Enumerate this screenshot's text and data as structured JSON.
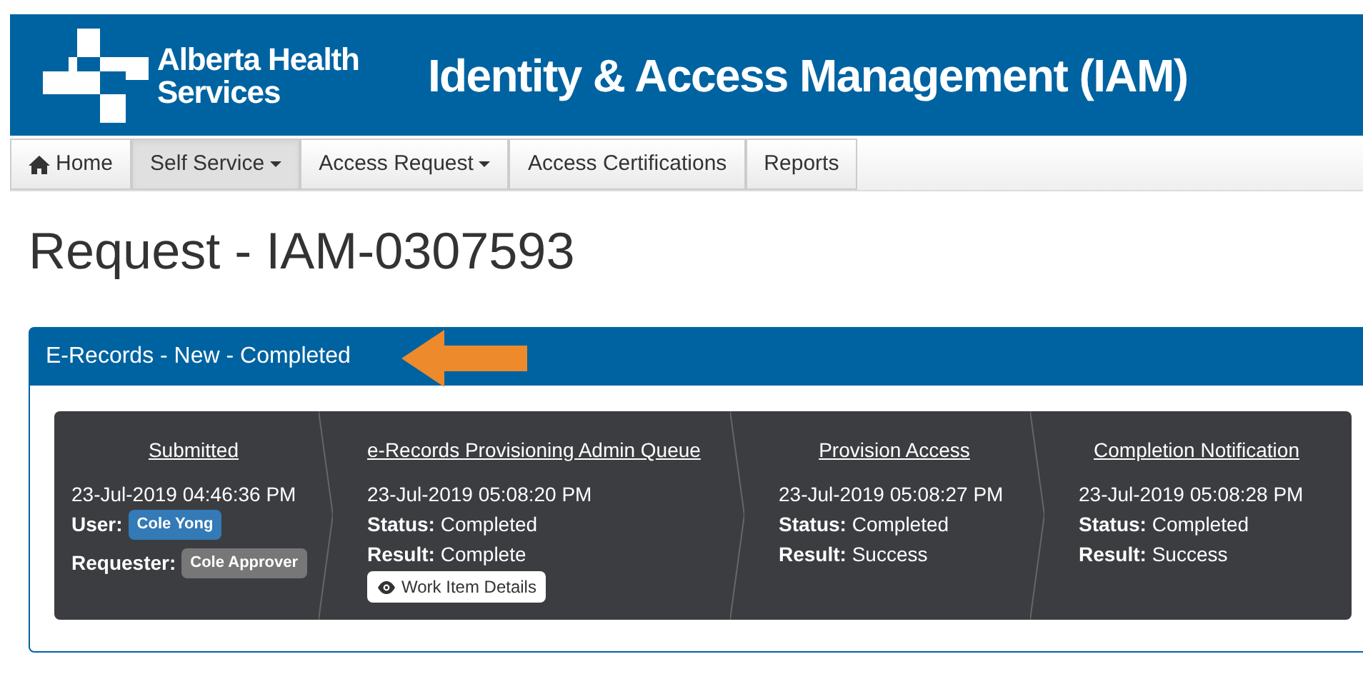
{
  "header": {
    "brand_line1": "Alberta Health",
    "brand_line2": "Services",
    "title": "Identity & Access Management (IAM)"
  },
  "nav": [
    {
      "label": "Home",
      "kind": "home",
      "dropdown": false,
      "selected": false
    },
    {
      "label": "Self Service",
      "kind": "menu",
      "dropdown": true,
      "selected": true
    },
    {
      "label": "Access Request",
      "kind": "menu",
      "dropdown": true,
      "selected": false
    },
    {
      "label": "Access Certifications",
      "kind": "menu",
      "dropdown": false,
      "selected": false
    },
    {
      "label": "Reports",
      "kind": "menu",
      "dropdown": false,
      "selected": false
    }
  ],
  "page_title": "Request - IAM-0307593",
  "panel": {
    "title": "E-Records - New - Completed",
    "steps": [
      {
        "title": "Submitted",
        "time": "23-Jul-2019 04:46:36 PM",
        "details": [
          {
            "kind": "badge",
            "label": "User:",
            "value": "Cole Yong",
            "color": "#337ab7"
          },
          {
            "kind": "badge",
            "label": "Requester:",
            "value": "Cole Approver",
            "color": "#777777"
          }
        ]
      },
      {
        "title": "e-Records Provisioning Admin Queue",
        "time": "23-Jul-2019 05:08:20 PM",
        "details": [
          {
            "kind": "text",
            "label": "Status:",
            "value": "Completed"
          },
          {
            "kind": "text",
            "label": "Result:",
            "value": "Complete"
          }
        ],
        "button": "Work Item Details"
      },
      {
        "title": "Provision Access",
        "time": "23-Jul-2019 05:08:27 PM",
        "details": [
          {
            "kind": "text",
            "label": "Status:",
            "value": "Completed"
          },
          {
            "kind": "text",
            "label": "Result:",
            "value": "Success"
          }
        ]
      },
      {
        "title": "Completion Notification",
        "time": "23-Jul-2019 05:08:28 PM",
        "details": [
          {
            "kind": "text",
            "label": "Status:",
            "value": "Completed"
          },
          {
            "kind": "text",
            "label": "Result:",
            "value": "Success"
          }
        ]
      }
    ]
  }
}
